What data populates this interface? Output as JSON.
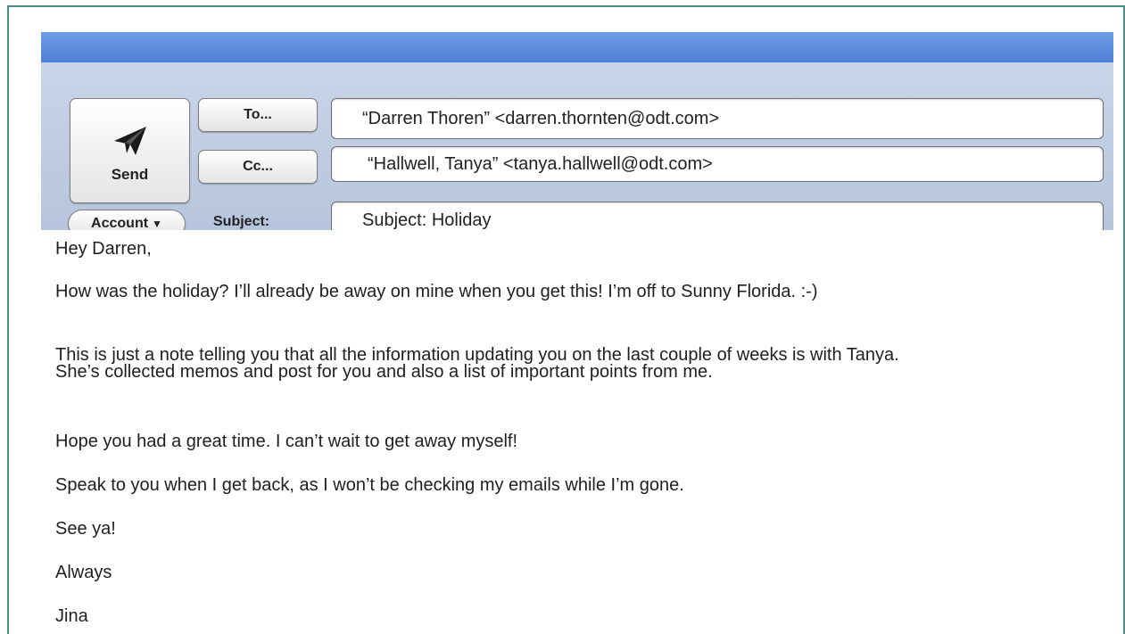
{
  "compose": {
    "send_label": "Send",
    "to_button_label": "To...",
    "cc_button_label": "Cc...",
    "account_label": "Account",
    "subject_label": "Subject:",
    "to_value": "“Darren Thoren” <darren.thornten@odt.com>",
    "cc_value": "“Hallwell, Tanya” <tanya.hallwell@odt.com>",
    "subject_value": "Subject: Holiday"
  },
  "message": {
    "greeting": "Hey Darren,",
    "para1": "How was the holiday? I’ll already be away on mine when you get this! I’m off to Sunny Florida. :-)",
    "para2": "This is just a note telling you that all the information updating you on the last couple of weeks is with Tanya. She’s collected memos and post for you and also a list of important points from me.",
    "para3": "Hope you had a great time. I can’t wait to get away myself!",
    "para4": "Speak to you when I get back, as I won’t be checking my emails while I’m gone.",
    "para5": "See ya!",
    "para6": "Always",
    "signature": "Jina"
  },
  "colors": {
    "titlebar": "#5a8bdc",
    "toolbar": "#c0cee4",
    "frame_border": "#4a8f86"
  },
  "icons": {
    "send": "paper-plane-icon",
    "account_caret": "caret-down-icon"
  }
}
